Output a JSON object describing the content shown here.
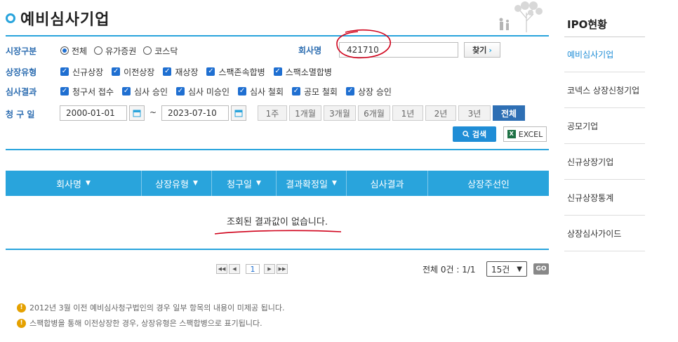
{
  "page": {
    "title": "예비심사기업"
  },
  "filters": {
    "market_label": "시장구분",
    "market_options": [
      "전체",
      "유가증권",
      "코스닥"
    ],
    "company_label": "회사명",
    "company_value": "421710",
    "find_label": "찾기",
    "listing_label": "상장유형",
    "listing_options": [
      "신규상장",
      "이전상장",
      "재상장",
      "스팩존속합병",
      "스팩소멸합병"
    ],
    "result_label": "심사결과",
    "result_options": [
      "청구서 접수",
      "심사 승인",
      "심사 미승인",
      "심사 철회",
      "공모 철회",
      "상장 승인"
    ],
    "date_label": "청 구 일",
    "date_from": "2000-01-01",
    "date_to": "2023-07-10",
    "periods": [
      "1주",
      "1개월",
      "3개월",
      "6개월",
      "1년",
      "2년",
      "3년",
      "전체"
    ],
    "search_label": "검색",
    "excel_label": "EXCEL"
  },
  "table": {
    "columns": [
      "회사명",
      "상장유형",
      "청구일",
      "결과확정일",
      "심사결과",
      "상장주선인"
    ],
    "empty_message": "조회된 결과값이 없습니다."
  },
  "pagination": {
    "current_page": "1",
    "count_text": "전체 0건 : 1/1",
    "page_size": "15건",
    "go_label": "GO"
  },
  "notes": [
    "2012년 3월 이전 예비심사청구법인의 경우 일부 항목의 내용이 미제공 됩니다.",
    "스팩합병을 통해 이전상장한 경우, 상장유형은 스팩합병으로 표기됩니다."
  ],
  "sidebar": {
    "title": "IPO현황",
    "items": [
      "예비심사기업",
      "코넥스 상장신청기업",
      "공모기업",
      "신규상장기업",
      "신규상장통계",
      "상장심사가이드"
    ]
  },
  "colors": {
    "accent": "#29a4dc",
    "checkbox": "#1f6fd1",
    "active_period": "#2e6fb4",
    "annotation": "#d0021b"
  }
}
